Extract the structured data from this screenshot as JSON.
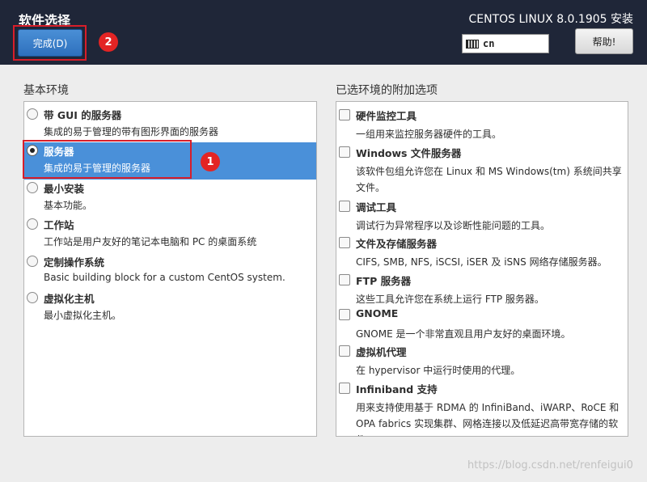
{
  "header": {
    "page_title": "软件选择",
    "product_title": "CENTOS LINUX 8.0.1905 安装",
    "done_label": "完成(D)",
    "keyboard_layout": "cn",
    "help_label": "帮助!"
  },
  "annotations": {
    "badge_1": "1",
    "badge_2": "2"
  },
  "base_environment": {
    "title": "基本环境",
    "selected_index": 1,
    "items": [
      {
        "name": "带 GUI 的服务器",
        "desc": "集成的易于管理的带有图形界面的服务器"
      },
      {
        "name": "服务器",
        "desc": "集成的易于管理的服务器"
      },
      {
        "name": "最小安装",
        "desc": "基本功能。"
      },
      {
        "name": "工作站",
        "desc": "工作站是用户友好的笔记本电脑和 PC 的桌面系统"
      },
      {
        "name": "定制操作系统",
        "desc": "Basic building block for a custom CentOS system."
      },
      {
        "name": "虚拟化主机",
        "desc": "最小虚拟化主机。"
      }
    ]
  },
  "addons": {
    "title": "已选环境的附加选项",
    "items": [
      {
        "name": "硬件监控工具",
        "desc": "一组用来监控服务器硬件的工具。"
      },
      {
        "name": "Windows 文件服务器",
        "desc": "该软件包组允许您在 Linux 和 MS Windows(tm) 系统间共享文件。"
      },
      {
        "name": "调试工具",
        "desc": "调试行为异常程序以及诊断性能问题的工具。"
      },
      {
        "name": "文件及存储服务器",
        "desc": "CIFS, SMB, NFS, iSCSI, iSER 及 iSNS 网络存储服务器。"
      },
      {
        "name": "FTP 服务器",
        "desc": "这些工具允许您在系统上运行 FTP 服务器。"
      },
      {
        "name": "GNOME",
        "desc": "GNOME 是一个非常直观且用户友好的桌面环境。"
      },
      {
        "name": "虚拟机代理",
        "desc": "在 hypervisor 中运行时使用的代理。"
      },
      {
        "name": "Infiniband 支持",
        "desc": "用来支持使用基于 RDMA 的 InfiniBand、iWARP、RoCE 和 OPA fabrics 实现集群、网格连接以及低延迟高带宽存储的软件。"
      }
    ]
  },
  "watermark": "https://blog.csdn.net/renfeigui0"
}
